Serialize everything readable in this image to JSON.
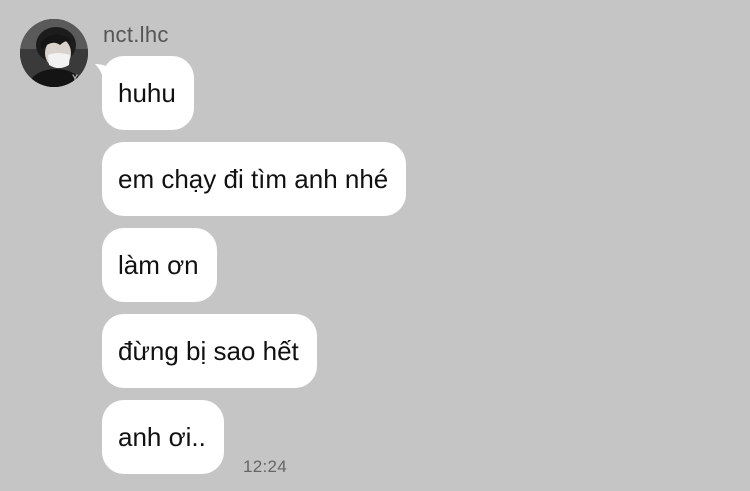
{
  "chat": {
    "sender": "nct.lhc",
    "avatar_icon": "profile-photo-person-in-mask",
    "messages": [
      {
        "text": "huhu"
      },
      {
        "text": "em chạy đi tìm anh nhé"
      },
      {
        "text": "làm ơn"
      },
      {
        "text": "đừng bị sao hết"
      },
      {
        "text": "anh ơi.."
      }
    ],
    "timestamp": "12:24"
  },
  "colors": {
    "background": "#c5c5c5",
    "bubble": "#ffffff",
    "text": "#111111",
    "meta_text": "#666666"
  }
}
